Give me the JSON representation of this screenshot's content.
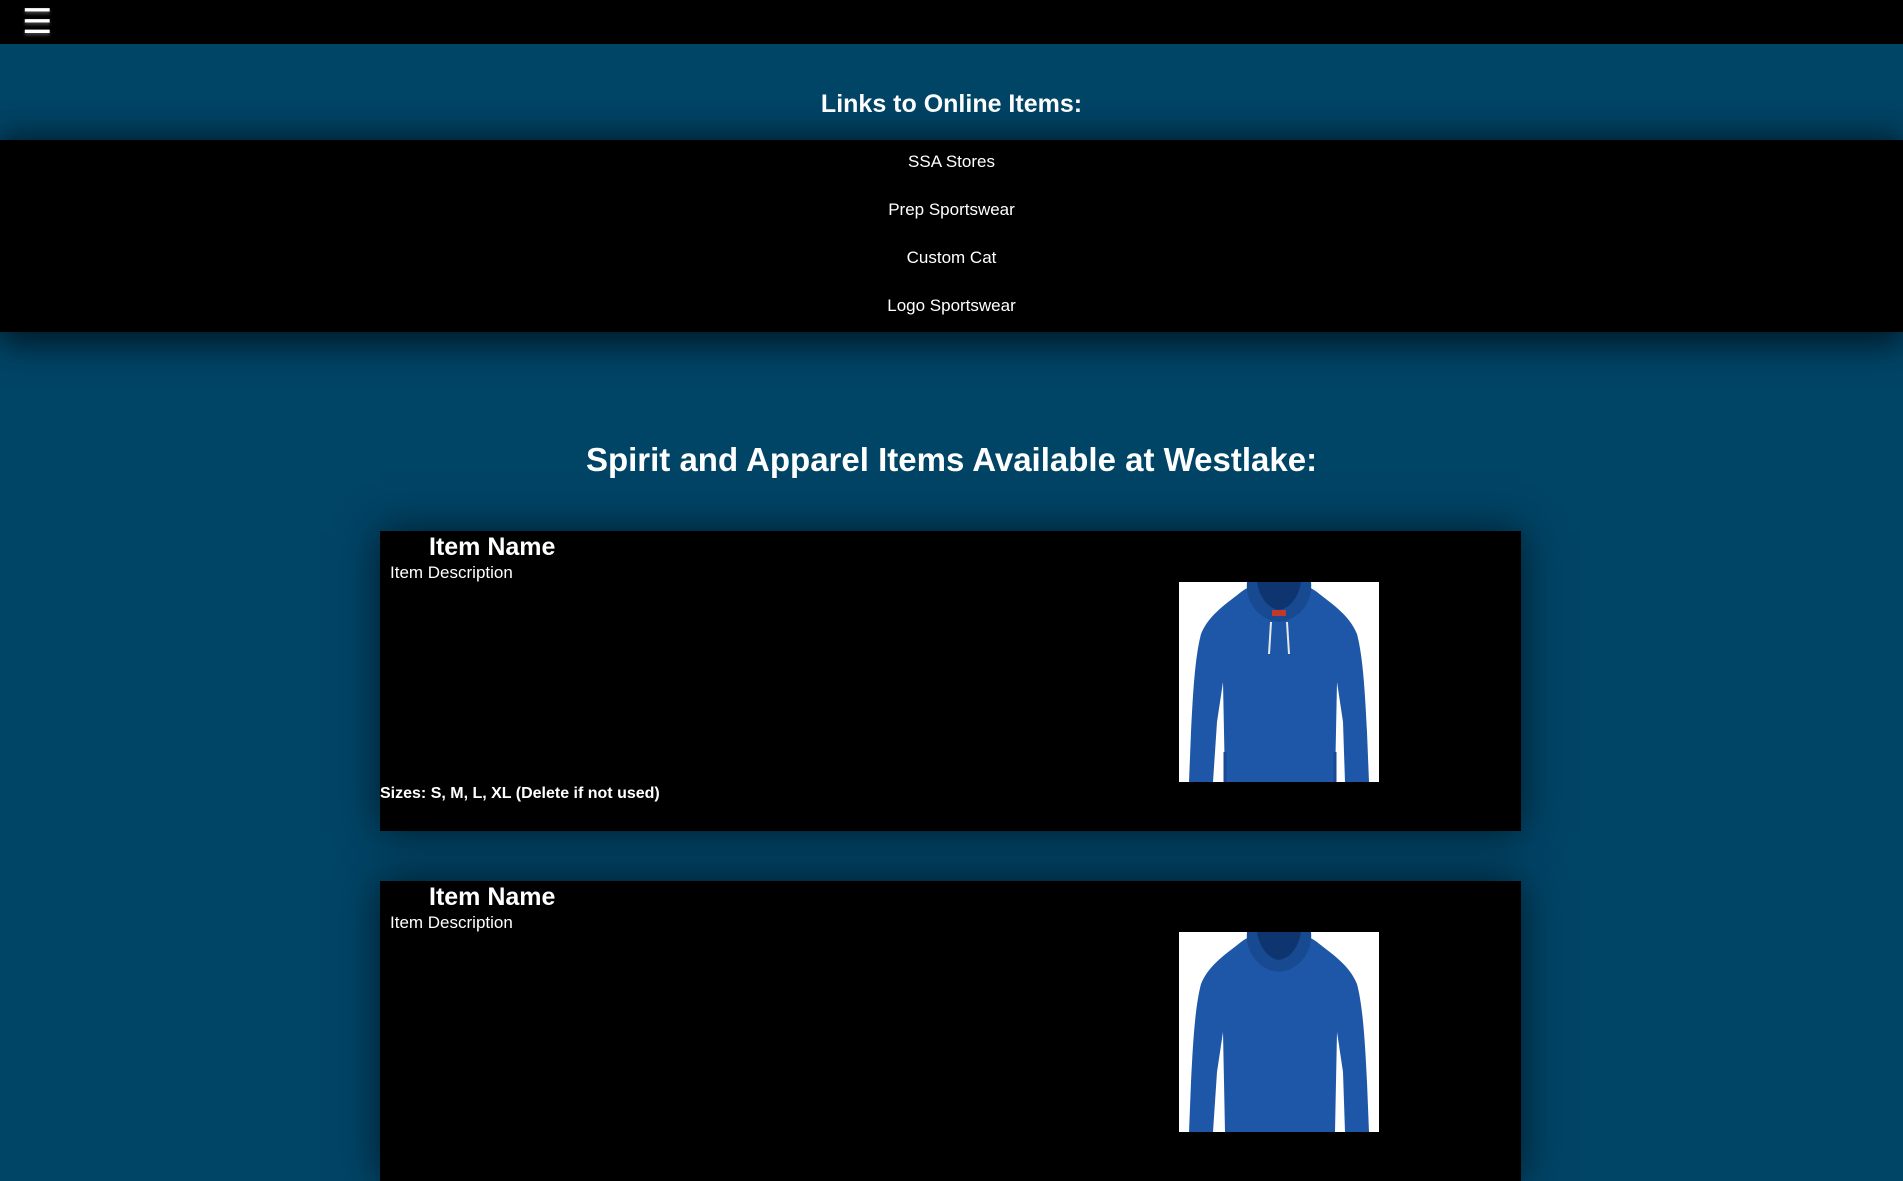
{
  "nav": {
    "menu_icon": "☰"
  },
  "links_section": {
    "title": "Links to Online Items:",
    "links": [
      {
        "label": "SSA Stores"
      },
      {
        "label": "Prep Sportswear"
      },
      {
        "label": "Custom Cat"
      },
      {
        "label": "Logo Sportswear"
      }
    ]
  },
  "items_section": {
    "title": "Spirit and Apparel Items Available at Westlake:",
    "items": [
      {
        "name": "Item Name",
        "description": "Item Description",
        "sizes": "Sizes: S, M, L, XL (Delete if not used)",
        "image_icon": "blue-hoodie-image"
      },
      {
        "name": "Item Name",
        "description": "Item Description",
        "image_icon": "blue-hoodie-image"
      }
    ]
  },
  "colors": {
    "background": "#004466",
    "band": "#000000",
    "hoodie": "#1f57a8"
  }
}
